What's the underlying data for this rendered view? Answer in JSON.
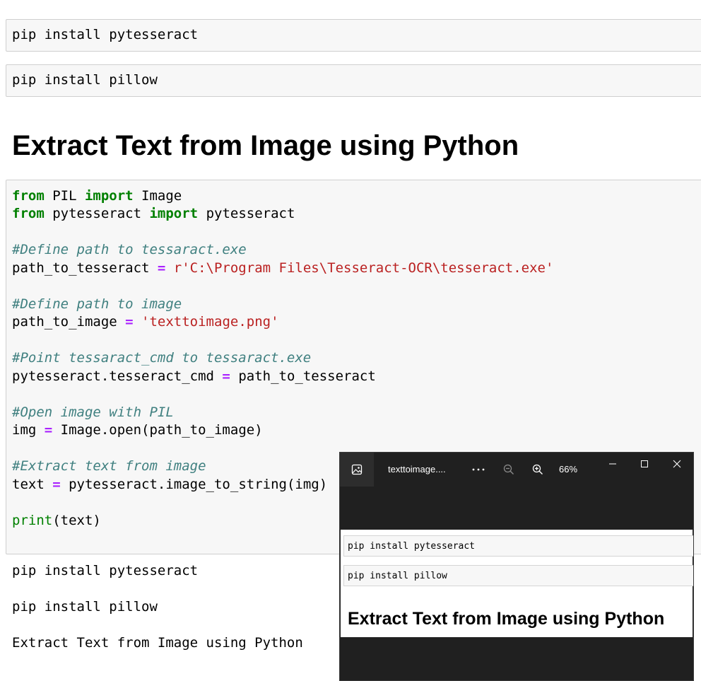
{
  "cells": {
    "install_tesseract": "pip install pytesseract",
    "install_pillow": "pip install pillow"
  },
  "heading": "Extract Text from Image using Python",
  "code": {
    "l1": {
      "kw1": "from",
      "mod": " PIL ",
      "kw2": "import",
      "name": " Image"
    },
    "l2": {
      "kw1": "from",
      "mod": " pytesseract ",
      "kw2": "import",
      "name": " pytesseract"
    },
    "l4": "#Define path to tessaract.exe",
    "l5": {
      "var": "path_to_tesseract ",
      "op": "=",
      "str": " r'C:\\Program Files\\Tesseract-OCR\\tesseract.exe'"
    },
    "l7": "#Define path to image",
    "l8": {
      "var": "path_to_image ",
      "op": "=",
      "str": " 'texttoimage.png'"
    },
    "l10": "#Point tessaract_cmd to tessaract.exe",
    "l11": {
      "var": "pytesseract.tesseract_cmd ",
      "op": "=",
      "rest": " path_to_tesseract"
    },
    "l13": "#Open image with PIL",
    "l14": {
      "var": "img ",
      "op": "=",
      "rest": " Image.open(path_to_image)"
    },
    "l16": "#Extract text from image",
    "l17": {
      "var": "text ",
      "op": "=",
      "rest": " pytesseract.image_to_string(img)"
    },
    "l19": {
      "fn": "print",
      "rest": "(text)"
    }
  },
  "output": {
    "line1": "pip install pytesseract",
    "line2": "pip install pillow",
    "line3": "Extract Text from Image using Python"
  },
  "viewer": {
    "title": "texttoimage....",
    "zoom": "66%",
    "image": {
      "cell1": "pip install pytesseract",
      "cell2": "pip install pillow",
      "heading": "Extract Text from Image using Python"
    }
  },
  "colors": {
    "keyword": "#008000",
    "comment": "#408080",
    "operator": "#aa22ff",
    "string": "#ba2121",
    "viewer_bg": "#202020"
  },
  "icons": [
    "photo-icon",
    "more-icon",
    "zoom-out-icon",
    "zoom-in-icon",
    "minimize-icon",
    "maximize-icon",
    "close-icon"
  ]
}
